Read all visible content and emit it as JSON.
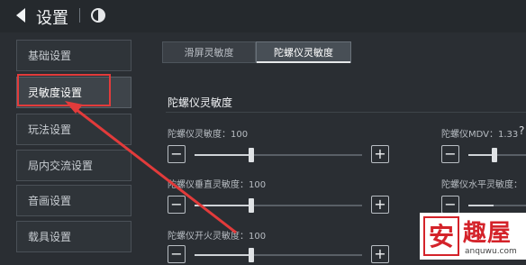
{
  "header": {
    "title": "设置",
    "back_icon": "back-arrow-icon",
    "network_icon": "signal-icon"
  },
  "sidebar": {
    "items": [
      {
        "label": "基础设置",
        "active": false
      },
      {
        "label": "灵敏度设置",
        "active": true
      },
      {
        "label": "玩法设置",
        "active": false
      },
      {
        "label": "局内交流设置",
        "active": false
      },
      {
        "label": "音画设置",
        "active": false
      },
      {
        "label": "载具设置",
        "active": false
      }
    ]
  },
  "tabs": [
    {
      "label": "滑屏灵敏度",
      "active": false
    },
    {
      "label": "陀螺仪灵敏度",
      "active": true
    }
  ],
  "section": {
    "title": "陀螺仪灵敏度"
  },
  "sliders": {
    "gyro_sensitivity": {
      "label": "陀螺仪灵敏度：100",
      "value": 100
    },
    "gyro_vertical": {
      "label": "陀螺仪垂直灵敏度：100",
      "value": 100
    },
    "gyro_fire": {
      "label": "陀螺仪开火灵敏度：100",
      "value": 100
    },
    "gyro_mdv": {
      "label": "陀螺仪MDV：1.33",
      "value": 1.33
    },
    "gyro_horizontal": {
      "label": "陀螺仪水平灵敏度："
    }
  },
  "help": {
    "symbol": "?"
  },
  "buttons": {
    "minus": "−",
    "plus": "+"
  },
  "watermark": {
    "brand": "趣屋",
    "logo_char": "安",
    "url": "anquwu.com"
  },
  "colors": {
    "accent_red": "#e23b3b",
    "watermark_red": "#d4232a"
  }
}
